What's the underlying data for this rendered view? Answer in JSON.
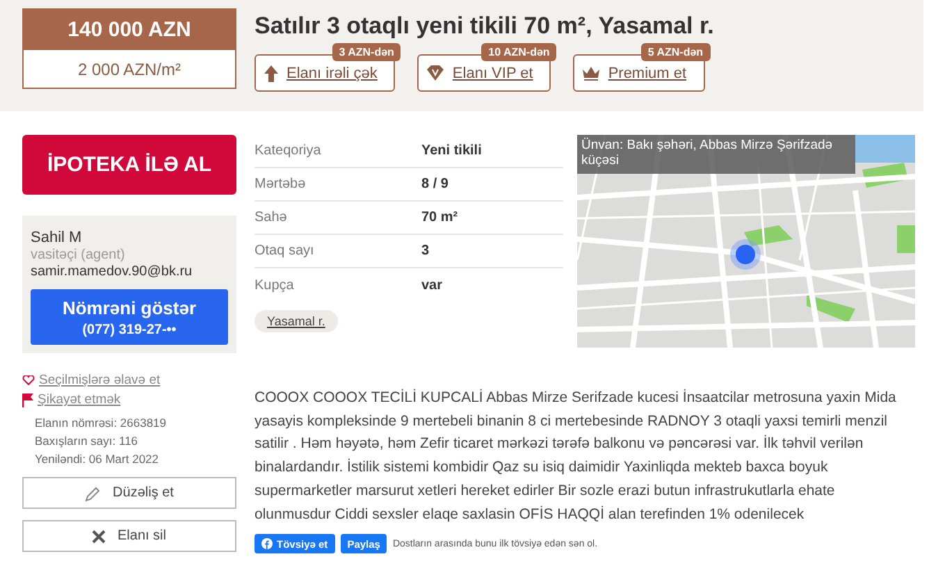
{
  "price": {
    "total": "140 000 AZN",
    "per_m2": "2 000 AZN/m²"
  },
  "title": "Satılır 3 otaqlı yeni tikili 70 m², Yasamal r.",
  "promo_buttons": [
    {
      "label": "Elanı irəli çək",
      "badge": "3 AZN-dən",
      "kind": "up"
    },
    {
      "label": "Elanı VIP et",
      "badge": "10 AZN-dən",
      "kind": "vip"
    },
    {
      "label": "Premium et",
      "badge": "5 AZN-dən",
      "kind": "premium"
    }
  ],
  "mortgage_button": "İPOTEKA İLƏ AL",
  "agent": {
    "name": "Sahil M",
    "role": "vasitəçi (agent)",
    "email": "samir.mamedov.90@bk.ru",
    "phone_button": "Nömrəni göstər",
    "phone": "(077) 319-27-••"
  },
  "links": [
    {
      "label": "Seçilmişlərə əlavə et",
      "kind": "heart"
    },
    {
      "label": "Şikayət etmək",
      "kind": "flag"
    }
  ],
  "stats": [
    "Elanın nömrəsi: 2663819",
    "Baxışların sayı: 116",
    "Yeniləndi: 06 Mart 2022"
  ],
  "actions": [
    {
      "label": "Düzəliş et",
      "kind": "edit"
    },
    {
      "label": "Elanı sil",
      "kind": "delete"
    }
  ],
  "properties": [
    {
      "label": "Kateqoriya",
      "value": "Yeni tikili"
    },
    {
      "label": "Mərtəbə",
      "value": "8 / 9"
    },
    {
      "label": "Sahə",
      "value": "70 m²"
    },
    {
      "label": "Otaq sayı",
      "value": "3"
    },
    {
      "label": "Kupça",
      "value": "var"
    }
  ],
  "location_tag": "Yasamal r.",
  "map": {
    "kind": "picture",
    "address": "Ünvan: Bakı şəhəri, Abbas Mirzə Şərifzadə küçəsi"
  },
  "description": "COOOX COOOX TECİLİ KUPCALİ Abbas Mirze Serifzade kucesi İnsaatcilar metrosuna yaxin Mida yasayis kompleksinde 9 mertebeli binanin 8 ci mertebesinde RADNOY 3 otaqli yaxsi temirli menzil satilir . Həm həyətə, həm Zefir ticaret mərkəzi tərəfə balkonu və pəncərəsi var. İlk təhvil verilən binalardandır. İstilik sistemi kombidir Qaz su isiq daimidir Yaxinliqda mekteb baxca boyuk supermarketler marsurut xetleri hereket edirler Bir sozle erazi butun infrastrukutlarla ehate olunmusdur Ciddi sexsler elaqe saxlasin OFİS HAQQİ alan terefinden 1% odenilecek",
  "share": {
    "recommend": "Tövsiyə et",
    "share": "Paylaş",
    "note": "Dostların arasında bunu ilk tövsiyə edən sən ol."
  }
}
